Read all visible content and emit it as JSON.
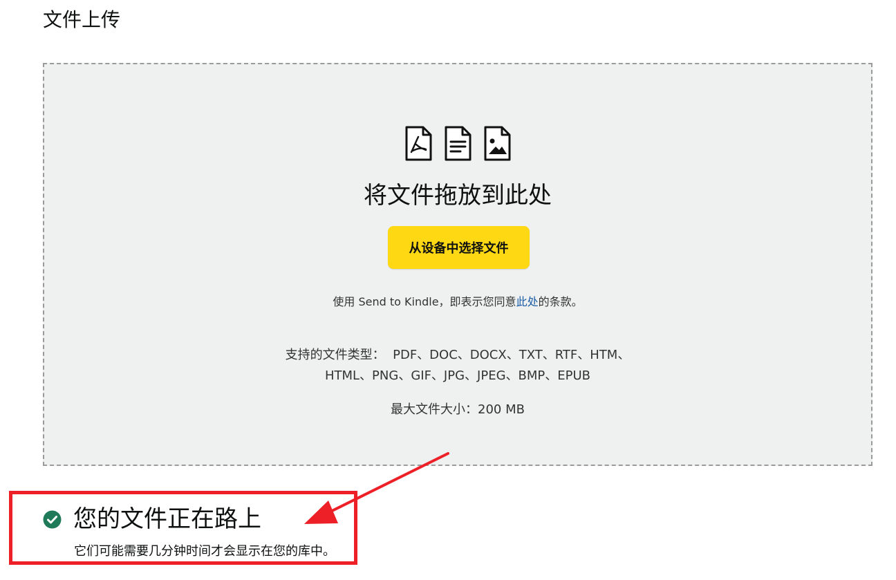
{
  "page": {
    "title": "文件上传"
  },
  "dropzone": {
    "icons": [
      "pdf-file-icon",
      "document-file-icon",
      "image-file-icon"
    ],
    "heading": "将文件拖放到此处",
    "choose_button_label": "从设备中选择文件",
    "terms_prefix": "使用 Send to Kindle，即表示您同意",
    "terms_link": "此处",
    "terms_suffix": "的条款。",
    "supported_label": "支持的文件类型：",
    "supported_line1": "PDF、DOC、DOCX、TXT、RTF、HTM、",
    "supported_line2": "HTML、PNG、GIF、JPG、JPEG、BMP、EPUB",
    "max_size_label": "最大文件大小：",
    "max_size_value": "200 MB"
  },
  "status": {
    "icon": "check-circle-icon",
    "title": "您的文件正在路上",
    "subtitle": "它们可能需要几分钟时间才会显示在您的库中。"
  },
  "colors": {
    "dropzone_bg": "#eff0f0",
    "button_bg": "#ffd814",
    "link": "#1a5da6",
    "success": "#1f7a5a",
    "annotation": "#ec2026"
  }
}
